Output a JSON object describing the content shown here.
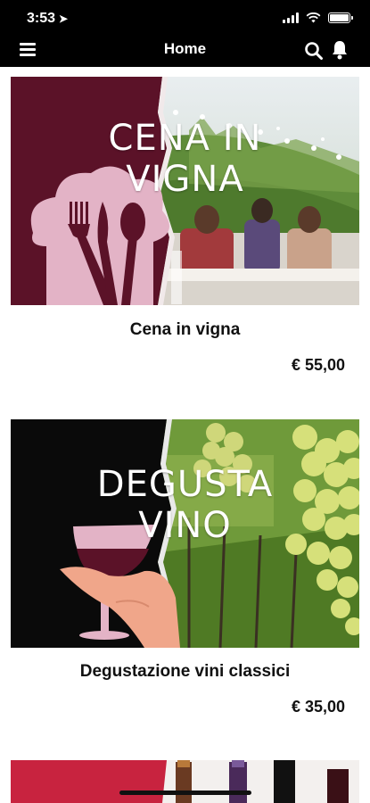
{
  "status_bar": {
    "time": "3:53"
  },
  "app_bar": {
    "title": "Home"
  },
  "products": [
    {
      "overlay_line1": "CENA IN",
      "overlay_line2": "VIGNA",
      "title": "Cena in vigna",
      "price": "€ 55,00"
    },
    {
      "overlay_line1": "DEGUSTA",
      "overlay_line2": "VINO",
      "title": "Degustazione vini classici",
      "price": "€ 35,00"
    }
  ],
  "colors": {
    "bar": "#000000",
    "wine": "#5b1228",
    "pink": "#e3b3c6",
    "banner_red": "#c8233f"
  }
}
